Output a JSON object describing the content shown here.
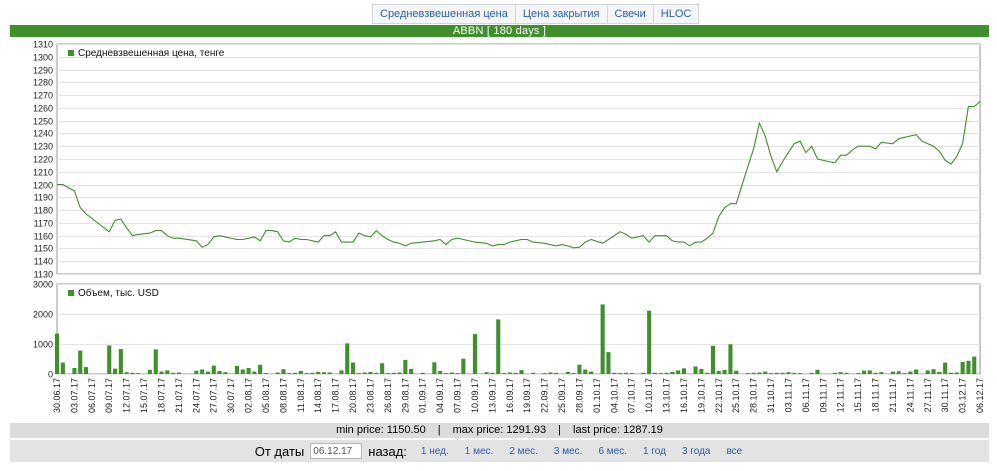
{
  "tabs": [
    "Средневзвешенная цена",
    "Цена закрытия",
    "Свечи",
    "HLOC"
  ],
  "header": {
    "title": "ABBN [ 180 days ]"
  },
  "colors": {
    "accent": "#3f8f2d",
    "line": "#3f8f2d",
    "bar": "#3f8f2d",
    "link": "#2a5db0"
  },
  "stats": {
    "min": "min price: 1150.50",
    "max": "max price: 1291.93",
    "last": "last price: 1287.19",
    "sep": "|"
  },
  "range": {
    "from_label": "От даты",
    "date_value": "06.12.17",
    "back_label": "назад:",
    "buttons": [
      "1 нед.",
      "1 мес.",
      "2 мес.",
      "3 мес.",
      "6 мес.",
      "1 год",
      "3 года",
      "все"
    ]
  },
  "chart_data": [
    {
      "type": "line",
      "legend": "Средневзвешенная цена, тенге",
      "ylim": [
        1130,
        1310
      ],
      "yticks": [
        1130,
        1140,
        1150,
        1160,
        1170,
        1180,
        1190,
        1200,
        1210,
        1220,
        1230,
        1240,
        1250,
        1260,
        1270,
        1280,
        1290,
        1300,
        1310
      ],
      "x_tick_labels": [
        "30.06.17",
        "03.07.17",
        "06.07.17",
        "09.07.17",
        "12.07.17",
        "15.07.17",
        "18.07.17",
        "21.07.17",
        "24.07.17",
        "27.07.17",
        "30.07.17",
        "02.08.17",
        "05.08.17",
        "08.08.17",
        "11.08.17",
        "14.08.17",
        "17.08.17",
        "20.08.17",
        "23.08.17",
        "26.08.17",
        "29.08.17",
        "01.09.17",
        "04.09.17",
        "07.09.17",
        "10.09.17",
        "13.09.17",
        "16.09.17",
        "19.09.17",
        "22.09.17",
        "25.09.17",
        "28.09.17",
        "01.10.17",
        "04.10.17",
        "07.10.17",
        "10.10.17",
        "13.10.17",
        "16.10.17",
        "19.10.17",
        "22.10.17",
        "25.10.17",
        "28.10.17",
        "31.10.17",
        "03.11.17",
        "06.11.17",
        "09.11.17",
        "12.11.17",
        "15.11.17",
        "18.11.17",
        "21.11.17",
        "24.11.17",
        "27.11.17",
        "30.11.17",
        "03.12.17",
        "06.12.17"
      ],
      "x_range_days": [
        0,
        159
      ],
      "series": [
        {
          "x_days": [
            0,
            1,
            3,
            4,
            5,
            9,
            10,
            11,
            12,
            13,
            14,
            16,
            17,
            18,
            19,
            20,
            21,
            24,
            25,
            26,
            27,
            28,
            29,
            31,
            32,
            33,
            34,
            35,
            36,
            37,
            38,
            39,
            40,
            41,
            42,
            43,
            44,
            45,
            46,
            47,
            48,
            49,
            50,
            51,
            52,
            53,
            54,
            55,
            56,
            57,
            58,
            59,
            60,
            61,
            63,
            65,
            66,
            67,
            68,
            69,
            70,
            72,
            74,
            75,
            76,
            77,
            78,
            79,
            80,
            81,
            82,
            84,
            85,
            86,
            87,
            88,
            89,
            90,
            91,
            92,
            94,
            95,
            96,
            97,
            98,
            99,
            101,
            102,
            103,
            104,
            105,
            106,
            107,
            108,
            109,
            110,
            111,
            112,
            113,
            114,
            115,
            116,
            117,
            119,
            120,
            121,
            122,
            123,
            124,
            125,
            126,
            127,
            128,
            129,
            130,
            131,
            133,
            134,
            135,
            136,
            137,
            138,
            139,
            140,
            141,
            142,
            144,
            145,
            146,
            147,
            148,
            149,
            150,
            151,
            152,
            153,
            154,
            155,
            156,
            157,
            158,
            159
          ],
          "values": [
            1200,
            1200,
            1195,
            1182,
            1177,
            1163,
            1172,
            1173,
            1166,
            1160,
            1161,
            1162,
            1164,
            1164,
            1160,
            1158,
            1158,
            1156,
            1151,
            1153,
            1159,
            1160,
            1159,
            1157,
            1157,
            1158,
            1159,
            1156,
            1164,
            1164,
            1163,
            1156,
            1155,
            1158,
            1157,
            1157,
            1156,
            1155,
            1160,
            1160,
            1163,
            1155,
            1155,
            1155,
            1162,
            1160,
            1159,
            1164,
            1160,
            1157,
            1155,
            1154,
            1152,
            1154,
            1155,
            1156,
            1157,
            1153,
            1157,
            1158,
            1157,
            1155,
            1154,
            1152,
            1153,
            1153,
            1155,
            1156,
            1157,
            1157,
            1155,
            1154,
            1153,
            1152,
            1153,
            1152,
            1150.5,
            1151,
            1155,
            1157,
            1154,
            1157,
            1160,
            1163,
            1161,
            1158,
            1160,
            1155,
            1160,
            1160,
            1160,
            1156,
            1155,
            1155,
            1152,
            1155,
            1155,
            1158,
            1162,
            1175,
            1182,
            1185,
            1185,
            1214,
            1228,
            1248,
            1238,
            1222,
            1210,
            1218,
            1225,
            1232,
            1234,
            1225,
            1230,
            1220,
            1218,
            1217,
            1223,
            1223,
            1227,
            1230,
            1230,
            1230,
            1228,
            1233,
            1232,
            1236,
            1237,
            1238,
            1239,
            1234,
            1232,
            1230,
            1226,
            1219,
            1216,
            1222,
            1232,
            1261,
            1261,
            1265,
            1271,
            1292,
            1287
          ]
        }
      ]
    },
    {
      "type": "bar",
      "legend": "Объем, тыс. USD",
      "ylim": [
        0,
        3000
      ],
      "yticks": [
        0,
        1000,
        2000,
        3000
      ],
      "x_range_days": [
        0,
        159
      ],
      "series": [
        {
          "x_days": [
            0,
            1,
            3,
            4,
            5,
            9,
            10,
            11,
            12,
            13,
            14,
            16,
            17,
            18,
            19,
            20,
            21,
            24,
            25,
            26,
            27,
            28,
            29,
            31,
            32,
            33,
            34,
            35,
            36,
            38,
            39,
            40,
            41,
            42,
            43,
            44,
            45,
            46,
            47,
            49,
            50,
            51,
            52,
            53,
            54,
            55,
            56,
            57,
            58,
            59,
            60,
            61,
            63,
            65,
            66,
            67,
            68,
            69,
            70,
            72,
            74,
            75,
            76,
            77,
            78,
            79,
            80,
            82,
            84,
            85,
            86,
            88,
            89,
            90,
            91,
            92,
            94,
            95,
            96,
            97,
            98,
            99,
            101,
            102,
            103,
            104,
            105,
            106,
            107,
            108,
            110,
            111,
            112,
            113,
            114,
            115,
            116,
            117,
            119,
            120,
            121,
            122,
            123,
            124,
            125,
            126,
            127,
            128,
            130,
            131,
            134,
            135,
            136,
            138,
            139,
            140,
            141,
            142,
            144,
            145,
            146,
            147,
            148,
            150,
            151,
            152,
            153,
            154,
            155,
            156,
            157,
            158,
            159
          ],
          "values": [
            1350,
            380,
            200,
            780,
            230,
            950,
            180,
            830,
            60,
            40,
            30,
            140,
            820,
            80,
            120,
            40,
            50,
            110,
            150,
            80,
            280,
            100,
            60,
            270,
            150,
            200,
            80,
            310,
            30,
            50,
            160,
            30,
            40,
            100,
            30,
            40,
            70,
            60,
            50,
            120,
            1020,
            380,
            30,
            50,
            70,
            40,
            360,
            30,
            40,
            50,
            470,
            170,
            40,
            390,
            100,
            30,
            50,
            30,
            510,
            1330,
            60,
            40,
            1820,
            30,
            50,
            40,
            130,
            40,
            30,
            50,
            40,
            70,
            30,
            310,
            150,
            80,
            2320,
            730,
            40,
            30,
            40,
            30,
            40,
            2110,
            40,
            30,
            40,
            70,
            120,
            190,
            250,
            170,
            40,
            940,
            100,
            140,
            990,
            110,
            30,
            40,
            50,
            80,
            30,
            40,
            40,
            60,
            40,
            30,
            40,
            140,
            40,
            60,
            40,
            30,
            110,
            120,
            40,
            60,
            80,
            90,
            30,
            80,
            150,
            120,
            160,
            70,
            380,
            40,
            50,
            400,
            440,
            580
          ]
        }
      ]
    }
  ]
}
